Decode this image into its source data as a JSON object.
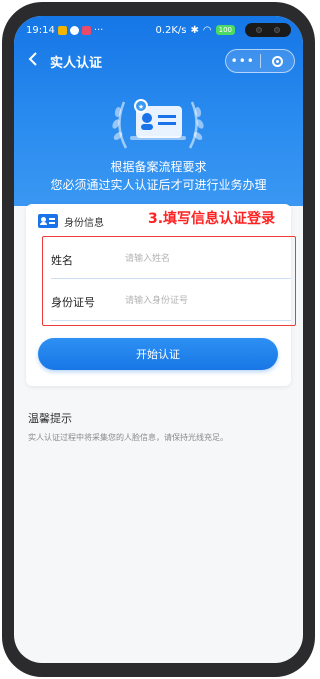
{
  "status_bar": {
    "time": "19:14",
    "ellipsis": "···",
    "speed": "0.2K/s",
    "battery": "100"
  },
  "navbar": {
    "back_icon": "chevron-left-icon",
    "title": "实人认证",
    "more_label": "•••"
  },
  "hero": {
    "line1": "根据备案流程要求",
    "line2": "您必须通过实人认证后才可进行业务办理"
  },
  "card": {
    "title": "身份信息",
    "annotation": "3.填写信息认证登录",
    "fields": [
      {
        "label": "姓名",
        "placeholder": "请输入姓名",
        "value": ""
      },
      {
        "label": "身份证号",
        "placeholder": "请输入身份证号",
        "value": ""
      }
    ],
    "submit_label": "开始认证"
  },
  "tips": {
    "title": "温馨提示",
    "body": "实人认证过程中将采集您的人脸信息，请保持光线充足。"
  },
  "colors": {
    "primary": "#1a73e8",
    "annotation_red": "#ef3b3b",
    "background": "#f6f7f9"
  }
}
